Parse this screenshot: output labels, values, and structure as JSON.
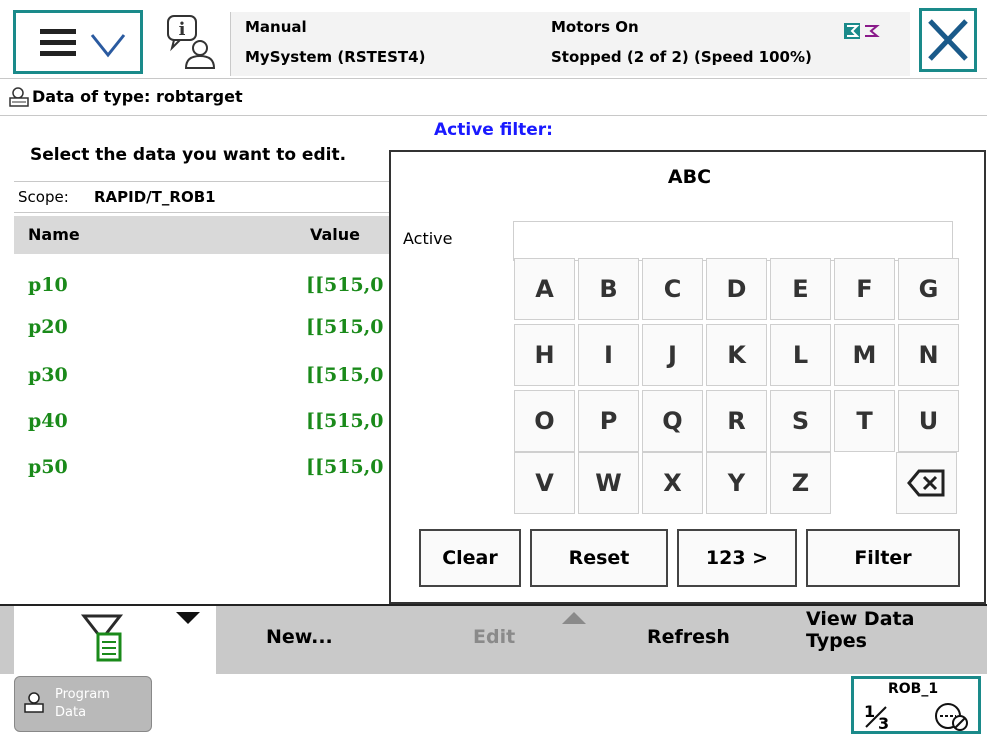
{
  "header": {
    "mode": "Manual",
    "system": "MySystem (RSTEST4)",
    "motors": "Motors On",
    "state": "Stopped (2 of 2) (Speed 100%)"
  },
  "title": "Data of type: robtarget",
  "list": {
    "instruction": "Select the data you want to edit.",
    "active_filter_label": "Active filter:",
    "scope_label": "Scope:",
    "scope_value": "RAPID/T_ROB1",
    "col_name": "Name",
    "col_value": "Value",
    "rows": [
      {
        "name": "p10",
        "value": "[[515,0"
      },
      {
        "name": "p20",
        "value": "[[515,0"
      },
      {
        "name": "p30",
        "value": "[[515,0"
      },
      {
        "name": "p40",
        "value": "[[515,0"
      },
      {
        "name": "p50",
        "value": "[[515,0"
      }
    ]
  },
  "dialog": {
    "title": "ABC",
    "active_label": "Active",
    "active_value": "",
    "keys": [
      "A",
      "B",
      "C",
      "D",
      "E",
      "F",
      "G",
      "H",
      "I",
      "J",
      "K",
      "L",
      "M",
      "N",
      "O",
      "P",
      "Q",
      "R",
      "S",
      "T",
      "U",
      "V",
      "W",
      "X",
      "Y",
      "Z"
    ],
    "clear": "Clear",
    "reset": "Reset",
    "numeric": "123 >",
    "filter": "Filter"
  },
  "toolbar": {
    "new": "New...",
    "edit": "Edit",
    "refresh": "Refresh",
    "view_types_1": "View Data",
    "view_types_2": "Types"
  },
  "statusbar": {
    "program_data_1": "Program",
    "program_data_2": "Data",
    "robot": "ROB_1"
  },
  "colors": {
    "accent": "#1a8a8a",
    "data_green": "#1a8a1a",
    "filter_blue": "#1a1aff"
  }
}
